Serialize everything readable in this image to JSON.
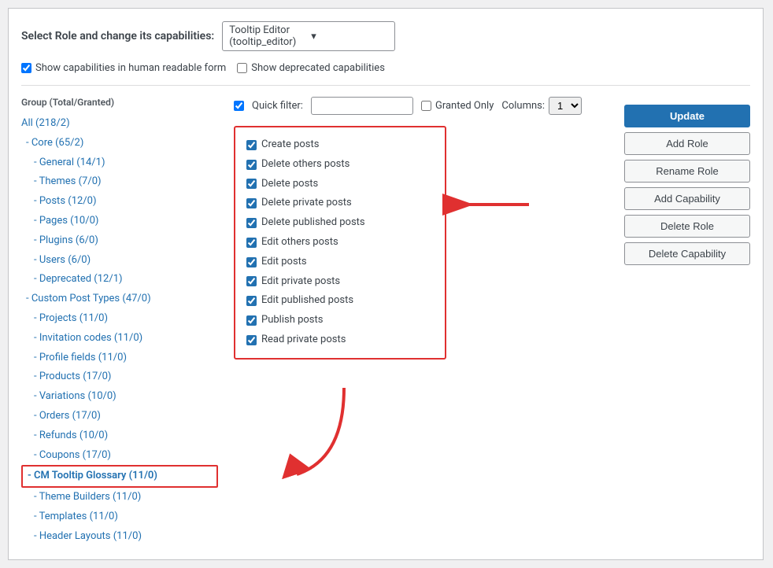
{
  "header": {
    "label": "Select Role and change its capabilities:",
    "role_value": "Tooltip Editor (tooltip_editor)",
    "dropdown_icon": "▾"
  },
  "checkboxes": {
    "human_readable_label": "Show capabilities in human readable form",
    "human_readable_checked": true,
    "deprecated_label": "Show deprecated capabilities",
    "deprecated_checked": false
  },
  "filter": {
    "quick_filter_label": "Quick filter:",
    "quick_filter_value": "",
    "quick_filter_placeholder": "",
    "granted_only_label": "Granted Only",
    "granted_only_checked": false,
    "columns_label": "Columns:",
    "columns_value": "1"
  },
  "sidebar": {
    "group_header": "Group (Total/Granted)",
    "items": [
      {
        "label": "All (218/2)",
        "indent": 0
      },
      {
        "label": "- Core (65/2)",
        "indent": 1
      },
      {
        "label": "- General (14/1)",
        "indent": 2
      },
      {
        "label": "- Themes (7/0)",
        "indent": 2
      },
      {
        "label": "- Posts (12/0)",
        "indent": 2
      },
      {
        "label": "- Pages (10/0)",
        "indent": 2
      },
      {
        "label": "- Plugins (6/0)",
        "indent": 2
      },
      {
        "label": "- Users (6/0)",
        "indent": 2
      },
      {
        "label": "- Deprecated (12/1)",
        "indent": 2
      },
      {
        "label": "- Custom Post Types (47/0)",
        "indent": 1
      },
      {
        "label": "- Projects (11/0)",
        "indent": 2
      },
      {
        "label": "- Invitation codes (11/0)",
        "indent": 2
      },
      {
        "label": "- Profile fields (11/0)",
        "indent": 2
      },
      {
        "label": "- Products (17/0)",
        "indent": 2
      },
      {
        "label": "- Variations (10/0)",
        "indent": 2
      },
      {
        "label": "- Orders (17/0)",
        "indent": 2
      },
      {
        "label": "- Refunds (10/0)",
        "indent": 2
      },
      {
        "label": "- Coupons (17/0)",
        "indent": 2
      },
      {
        "label": "- CM Tooltip Glossary (11/0)",
        "indent": 2,
        "highlighted": true
      },
      {
        "label": "- Theme Builders (11/0)",
        "indent": 2
      },
      {
        "label": "- Templates (11/0)",
        "indent": 2
      },
      {
        "label": "- Header Layouts (11/0)",
        "indent": 2
      }
    ]
  },
  "capabilities": [
    {
      "label": "Create posts",
      "checked": true
    },
    {
      "label": "Delete others posts",
      "checked": true
    },
    {
      "label": "Delete posts",
      "checked": true
    },
    {
      "label": "Delete private posts",
      "checked": true
    },
    {
      "label": "Delete published posts",
      "checked": true
    },
    {
      "label": "Edit others posts",
      "checked": true
    },
    {
      "label": "Edit posts",
      "checked": true
    },
    {
      "label": "Edit private posts",
      "checked": true
    },
    {
      "label": "Edit published posts",
      "checked": true
    },
    {
      "label": "Publish posts",
      "checked": true
    },
    {
      "label": "Read private posts",
      "checked": true
    }
  ],
  "buttons": {
    "update": "Update",
    "add_role": "Add Role",
    "rename_role": "Rename Role",
    "add_capability": "Add Capability",
    "delete_role": "Delete Role",
    "delete_capability": "Delete Capability"
  }
}
